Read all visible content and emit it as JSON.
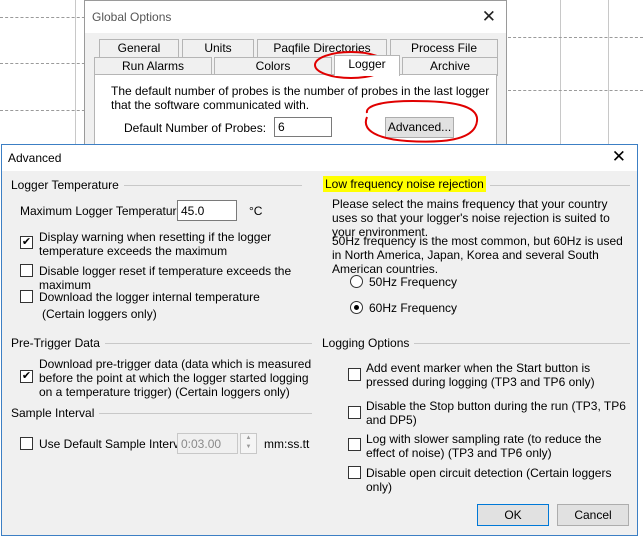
{
  "global_options": {
    "title": "Global Options",
    "tabs_row1": [
      "General",
      "Units",
      "Paqfile Directories",
      "Process File"
    ],
    "tabs_row2": [
      "Run Alarms",
      "Colors",
      "Logger",
      "Archive"
    ],
    "active_tab": "Logger",
    "description": "The default number of probes is the number of probes in the last logger that the software communicated with.",
    "probes_label": "Default Number of Probes:",
    "probes_value": "6",
    "advanced_button": "Advanced..."
  },
  "advanced": {
    "title": "Advanced",
    "logger_temperature": {
      "heading": "Logger Temperature",
      "max_label": "Maximum Logger Temperature:",
      "max_value": "45.0",
      "unit": "°C",
      "display_warning": "Display warning when resetting if the logger temperature exceeds the maximum",
      "display_warning_checked": true,
      "disable_reset": "Disable logger reset if temperature exceeds the maximum",
      "disable_reset_checked": false,
      "download_internal": "Download the logger internal temperature",
      "download_internal_note": "(Certain loggers only)",
      "download_internal_checked": false
    },
    "noise_rejection": {
      "heading": "Low frequency noise rejection",
      "para1": "Please select the mains frequency that your country uses so that your logger's noise rejection is suited to your environment.",
      "para2": "50Hz frequency is the most common, but 60Hz is used in North America, Japan, Korea and several South American countries.",
      "option_50": "50Hz Frequency",
      "option_60": "60Hz Frequency",
      "selected": "60Hz Frequency"
    },
    "pre_trigger": {
      "heading": "Pre-Trigger Data",
      "download": "Download pre-trigger data (data which is measured before the point at which the logger started logging on a temperature trigger) (Certain loggers only)",
      "download_checked": true
    },
    "sample_interval": {
      "heading": "Sample Interval",
      "use_default": "Use Default Sample Interval",
      "use_default_checked": false,
      "value": "0:03.00",
      "unit": "mm:ss.tt"
    },
    "logging_options": {
      "heading": "Logging Options",
      "items": [
        "Add event marker when the Start button is pressed during logging (TP3 and TP6 only)",
        "Disable the Stop button during the run (TP3, TP6 and DP5)",
        "Log with slower sampling rate (to reduce the effect of noise) (TP3 and TP6 only)",
        "Disable open circuit detection (Certain loggers only)"
      ]
    },
    "ok_button": "OK",
    "cancel_button": "Cancel"
  },
  "colors": {
    "highlight": "#ffff00",
    "annotation": "#e00000",
    "focus_border": "#0078d7"
  },
  "icons": {
    "close": "close-icon",
    "check": "checkmark-icon",
    "spin_up": "spin-up-icon",
    "spin_down": "spin-down-icon"
  }
}
